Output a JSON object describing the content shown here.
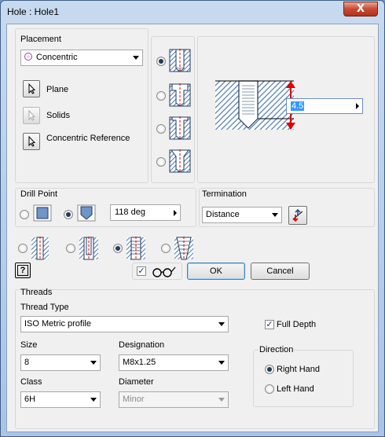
{
  "window": {
    "title": "Hole : Hole1",
    "close_label": "X"
  },
  "placement": {
    "title": "Placement",
    "method": "Concentric",
    "options": [
      {
        "label": "Plane"
      },
      {
        "label": "Solids"
      },
      {
        "label": "Concentric Reference"
      }
    ]
  },
  "preview": {
    "depth_value": "4.5"
  },
  "drill_point": {
    "title": "Drill Point",
    "angle": "118 deg"
  },
  "termination": {
    "title": "Termination",
    "value": "Distance"
  },
  "buttons": {
    "ok": "OK",
    "cancel": "Cancel",
    "help": "?"
  },
  "threads": {
    "title": "Threads",
    "thread_type_label": "Thread Type",
    "thread_type": "ISO Metric profile",
    "full_depth_label": "Full Depth",
    "size_label": "Size",
    "size": "8",
    "designation_label": "Designation",
    "designation": "M8x1.25",
    "class_label": "Class",
    "class": "6H",
    "diameter_label": "Diameter",
    "diameter": "Minor",
    "direction": {
      "title": "Direction",
      "right_hand": "Right Hand",
      "left_hand": "Left Hand",
      "selected": "Right Hand"
    }
  },
  "colors": {
    "hatch": "#4a78b4",
    "axis_red": "#e00000"
  }
}
